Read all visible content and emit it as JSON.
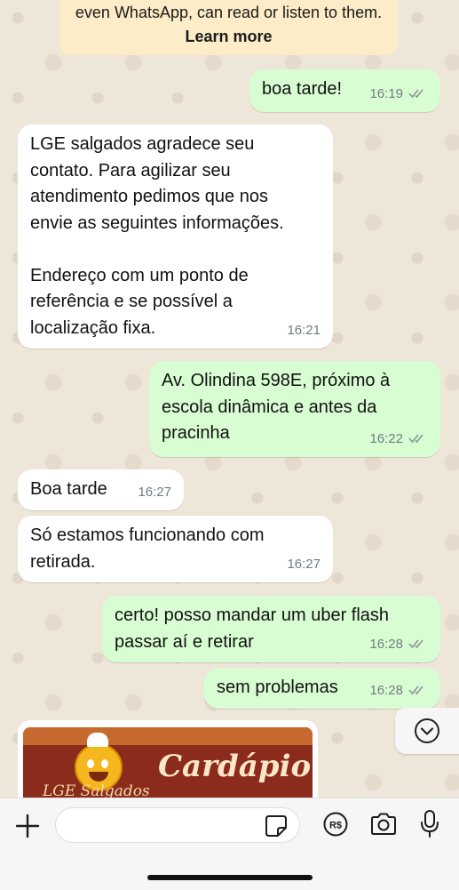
{
  "notice": {
    "line": "even WhatsApp, can read or listen to them.",
    "learn_more": "Learn more"
  },
  "messages": [
    {
      "dir": "out",
      "text": "boa tarde!",
      "time": "16:19",
      "read": true
    },
    {
      "dir": "in",
      "text": "LGE salgados agradece seu\ncontato. Para agilizar seu\natendimento pedimos que nos\nenvie as seguintes informações.\n\nEndereço com um ponto de\nreferência e se possível a\nlocalização fixa.",
      "time": "16:21"
    },
    {
      "dir": "out",
      "text": "Av. Olindina 598E, próximo à\nescola dinâmica e antes da\npracinha",
      "time": "16:22",
      "read": true
    },
    {
      "dir": "in",
      "text": "Boa tarde",
      "time": "16:27"
    },
    {
      "dir": "in",
      "text": "Só estamos funcionando com\nretirada.",
      "time": "16:27"
    },
    {
      "dir": "out",
      "text": "certo! posso mandar um uber flash\npassar aí e retirar",
      "time": "16:28",
      "read": true
    },
    {
      "dir": "out",
      "text": "sem problemas",
      "time": "16:28",
      "read": true
    }
  ],
  "image_message": {
    "title": "Cardápio",
    "brand": "LGE Salgados"
  },
  "composer": {
    "value": "",
    "placeholder": ""
  },
  "icons": {
    "scroll": "chevron-down-icon",
    "attach": "plus-icon",
    "sticker": "sticker-icon",
    "payment": "payment-icon",
    "camera": "camera-icon",
    "mic": "microphone-icon"
  },
  "colors": {
    "outgoing_bubble": "#d9fdd3",
    "incoming_bubble": "#ffffff",
    "read_ticks": "#53bdeb",
    "notice_bg": "#fcecc8"
  }
}
